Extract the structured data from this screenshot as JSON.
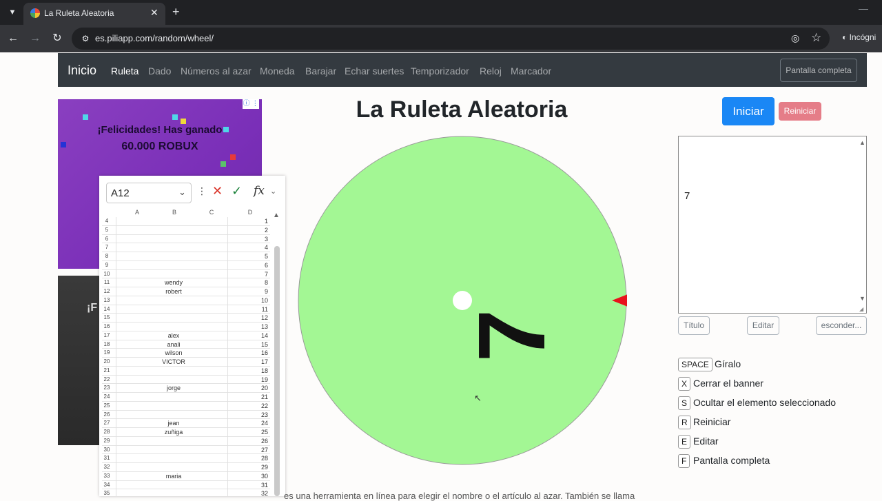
{
  "browser": {
    "tab_title": "La Ruleta Aleatoria",
    "url": "es.piliapp.com/random/wheel/",
    "incognito_label": "Incógni"
  },
  "nav": {
    "brand": "Inicio",
    "links": [
      "Ruleta",
      "Dado",
      "Números al azar",
      "Moneda",
      "Barajar",
      "Echar suertes",
      "Temporizador",
      "Reloj",
      "Marcador"
    ],
    "fullscreen": "Pantalla completa"
  },
  "ad": {
    "line1": "¡Felicidades! Has ganado",
    "line2": "60.000 ROBUX",
    "ad2_text": "¡F"
  },
  "sheet": {
    "namebox": "A12",
    "fx": "fx",
    "columns": [
      "A",
      "B",
      "C",
      "D"
    ],
    "rows": [
      {
        "n": "4",
        "name": "",
        "v": "1"
      },
      {
        "n": "5",
        "name": "",
        "v": "2"
      },
      {
        "n": "6",
        "name": "",
        "v": "3"
      },
      {
        "n": "7",
        "name": "",
        "v": "4"
      },
      {
        "n": "8",
        "name": "",
        "v": "5"
      },
      {
        "n": "9",
        "name": "",
        "v": "6"
      },
      {
        "n": "10",
        "name": "",
        "v": "7"
      },
      {
        "n": "11",
        "name": "wendy",
        "v": "8"
      },
      {
        "n": "12",
        "name": "robert",
        "v": "9"
      },
      {
        "n": "13",
        "name": "",
        "v": "10"
      },
      {
        "n": "14",
        "name": "",
        "v": "11"
      },
      {
        "n": "15",
        "name": "",
        "v": "12"
      },
      {
        "n": "16",
        "name": "",
        "v": "13"
      },
      {
        "n": "17",
        "name": "alex",
        "v": "14"
      },
      {
        "n": "18",
        "name": "anali",
        "v": "15"
      },
      {
        "n": "19",
        "name": "wilson",
        "v": "16"
      },
      {
        "n": "20",
        "name": "VICTOR",
        "v": "17"
      },
      {
        "n": "21",
        "name": "",
        "v": "18"
      },
      {
        "n": "22",
        "name": "",
        "v": "19"
      },
      {
        "n": "23",
        "name": "jorge",
        "v": "20"
      },
      {
        "n": "24",
        "name": "",
        "v": "21"
      },
      {
        "n": "25",
        "name": "",
        "v": "22"
      },
      {
        "n": "26",
        "name": "",
        "v": "23"
      },
      {
        "n": "27",
        "name": "jean",
        "v": "24"
      },
      {
        "n": "28",
        "name": "zuñiga",
        "v": "25"
      },
      {
        "n": "29",
        "name": "",
        "v": "26"
      },
      {
        "n": "30",
        "name": "",
        "v": "27"
      },
      {
        "n": "31",
        "name": "",
        "v": "28"
      },
      {
        "n": "32",
        "name": "",
        "v": "29"
      },
      {
        "n": "33",
        "name": "maria",
        "v": "30"
      },
      {
        "n": "34",
        "name": "",
        "v": "31"
      },
      {
        "n": "35",
        "name": "",
        "v": "32"
      }
    ]
  },
  "main": {
    "title": "La Ruleta Aleatoria",
    "wheel_label": "7",
    "wheel_color": "#a3f794",
    "pointer_color": "#e8121c"
  },
  "panel": {
    "start": "Iniciar",
    "reset": "Reiniciar",
    "entries_value": "7",
    "btn_title": "Título",
    "btn_edit": "Editar",
    "btn_hide": "esconder...",
    "shortcuts": [
      {
        "key": "SPACE",
        "label": "Gíralo"
      },
      {
        "key": "X",
        "label": "Cerrar el banner"
      },
      {
        "key": "S",
        "label": "Ocultar el elemento seleccionado"
      },
      {
        "key": "R",
        "label": "Reiniciar"
      },
      {
        "key": "E",
        "label": "Editar"
      },
      {
        "key": "F",
        "label": "Pantalla completa"
      }
    ]
  },
  "footer": {
    "text": "es una herramienta en línea para elegir el nombre o el artículo al azar. También se llama"
  },
  "colors": {
    "navbar": "#343a40",
    "primary": "#1a87f5",
    "danger_light": "#e57d88"
  }
}
